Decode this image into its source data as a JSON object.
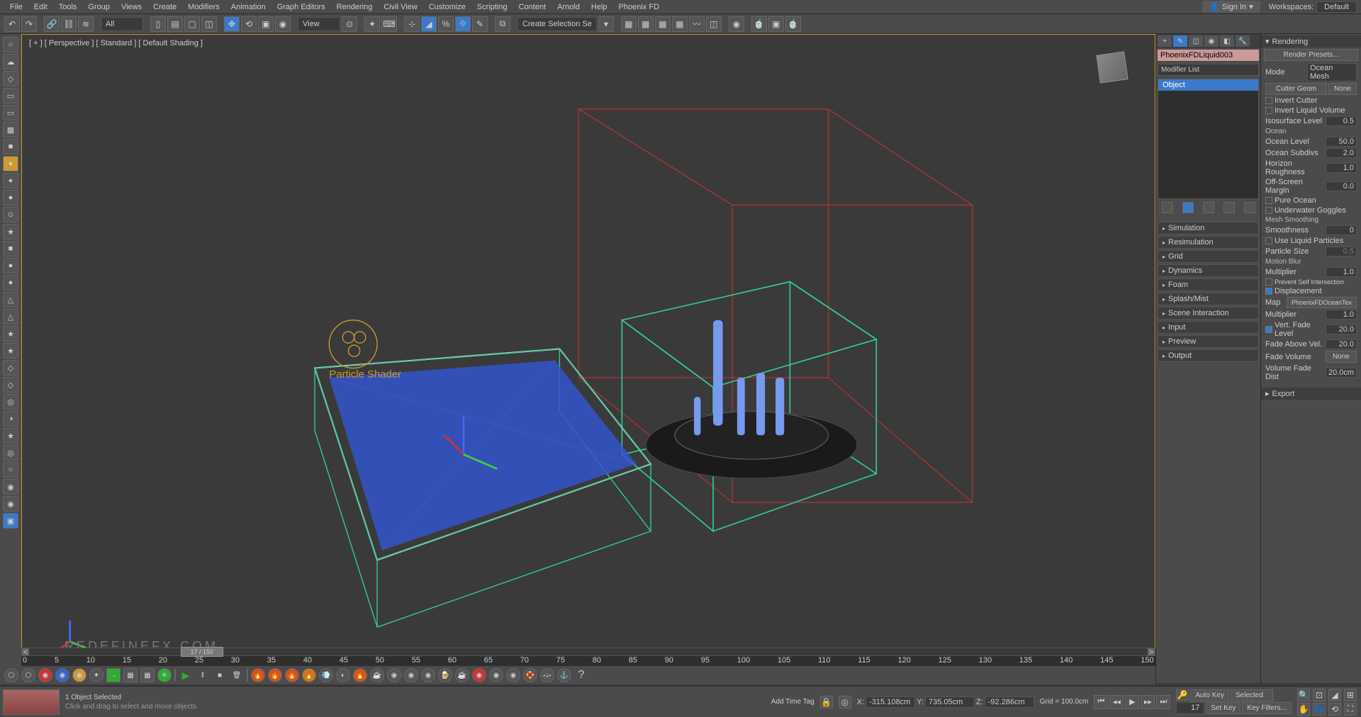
{
  "menu": {
    "items": [
      "File",
      "Edit",
      "Tools",
      "Group",
      "Views",
      "Create",
      "Modifiers",
      "Animation",
      "Graph Editors",
      "Rendering",
      "Civil View",
      "Customize",
      "Scripting",
      "Content",
      "Arnold",
      "Help",
      "Phoenix FD"
    ],
    "signin": "Sign In",
    "workspace_label": "Workspaces:",
    "workspace_value": "Default"
  },
  "toolbar": {
    "all_label": "All",
    "view_label": "View",
    "create_sel_set": "Create Selection Se"
  },
  "left_icons": [
    "○",
    "☁",
    "◇",
    "▭",
    "▭",
    "▦",
    "■",
    "●",
    "✦",
    "●",
    "☺",
    "★",
    "■",
    "●",
    "●",
    "△",
    "△",
    "★",
    "★",
    "◇",
    "◇",
    "◎",
    "◑",
    "★",
    "◎",
    "○",
    "◉",
    "◉",
    "▣"
  ],
  "viewport": {
    "label_parts": [
      "[ + ]",
      "[ Perspective ]",
      "[ Standard ]",
      "[ Default Shading ]"
    ],
    "particle_label": "Particle Shader",
    "watermark": "REDEFINEFX.COM"
  },
  "cmd": {
    "object_name": "PhoenixFDLiquid003",
    "modifier_list": "Modifier List",
    "stack_item": "Object",
    "rollouts": [
      "Simulation",
      "Resimulation",
      "Grid",
      "Dynamics",
      "Foam",
      "Splash/Mist",
      "Scene Interaction",
      "Input",
      "Preview",
      "Output"
    ]
  },
  "attr": {
    "header": "Rendering",
    "render_presets": "Render Presets...",
    "mode_label": "Mode",
    "mode_value": "Ocean Mesh",
    "cutter_geom": "Cutter Geom",
    "cutter_geom_val": "None",
    "invert_cutter": "Invert Cutter",
    "invert_liquid": "Invert Liquid Volume",
    "isosurface_label": "Isosurface Level",
    "isosurface_val": "0.5",
    "ocean_header": "Ocean",
    "ocean_level_label": "Ocean Level",
    "ocean_level_val": "50.0",
    "ocean_subdivs_label": "Ocean Subdivs",
    "ocean_subdivs_val": "2.0",
    "horizon_label": "Horizon Roughness",
    "horizon_val": "1.0",
    "offscreen_label": "Off-Screen Margin",
    "offscreen_val": "0.0",
    "pure_ocean": "Pure Ocean",
    "underwater": "Underwater Goggles",
    "mesh_smooth_header": "Mesh Smoothing",
    "smoothness_label": "Smoothness",
    "smoothness_val": "0",
    "use_liquid": "Use Liquid Particles",
    "particle_size_label": "Particle Size",
    "particle_size_val": "0.5",
    "motion_blur_header": "Motion Blur",
    "multiplier1_label": "Multiplier",
    "multiplier1_val": "1.0",
    "prevent_self": "Prevent Self Intersection",
    "displacement": "Displacement",
    "map_label": "Map",
    "map_val": "PhoenixFDOceanTex",
    "multiplier2_label": "Multiplier",
    "multiplier2_val": "1.0",
    "vert_fade_label": "Vert. Fade Level",
    "vert_fade_val": "20.0",
    "fade_above_label": "Fade Above Vel.",
    "fade_above_val": "20.0",
    "fade_volume_label": "Fade Volume",
    "fade_volume_val": "None",
    "volume_fade_label": "Volume Fade Dist",
    "volume_fade_val": "20.0cm",
    "export_header": "Export"
  },
  "timeline": {
    "thumb": "17 / 150",
    "ticks": [
      "0",
      "5",
      "10",
      "15",
      "20",
      "25",
      "30",
      "35",
      "40",
      "45",
      "50",
      "55",
      "60",
      "65",
      "70",
      "75",
      "80",
      "85",
      "90",
      "95",
      "100",
      "105",
      "110",
      "115",
      "120",
      "125",
      "130",
      "135",
      "140",
      "145",
      "150"
    ]
  },
  "status": {
    "selected": "1 Object Selected",
    "hint": "Click and drag to select and move objects",
    "add_time_tag": "Add Time Tag",
    "x_label": "X:",
    "x_val": "-315.108cm",
    "y_label": "Y:",
    "y_val": "735.05cm",
    "z_label": "Z:",
    "z_val": "-92.286cm",
    "grid_label": "Grid = 100.0cm",
    "frame": "17",
    "autokey": "Auto Key",
    "setkey": "Set Key",
    "selected_filter": "Selected",
    "key_filters": "Key Filters..."
  },
  "bottom_row_icons": [
    "⬡",
    "⬡",
    "◉",
    "◉",
    "◉",
    "✦",
    "→",
    "▦",
    "▦",
    "✳",
    "|",
    "▶",
    "‖",
    "■",
    "🗑",
    "|",
    "🔥",
    "🔥",
    "🔥",
    "🔥",
    "💨",
    "◐",
    "🔥",
    "☕",
    "◉",
    "◉",
    "◉",
    "🍺",
    "☕",
    "◉",
    "◉",
    "◉",
    "🛟",
    "🚓",
    "⚓",
    "?"
  ]
}
